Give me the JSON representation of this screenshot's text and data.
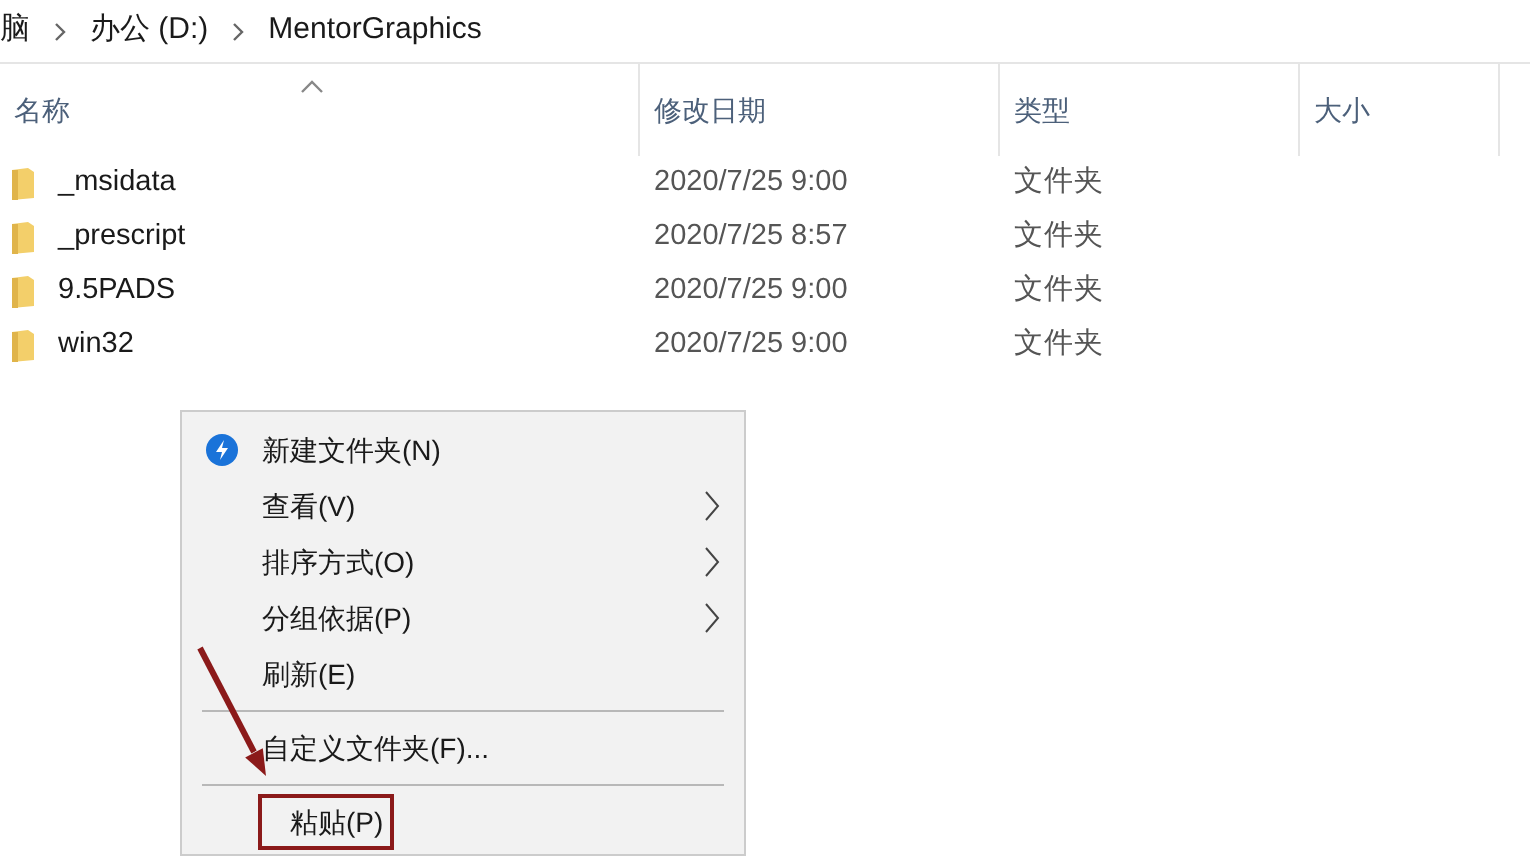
{
  "breadcrumb": [
    "脑",
    "办公 (D:)",
    "MentorGraphics"
  ],
  "table": {
    "columns": [
      {
        "label": "名称",
        "sorted": true
      },
      {
        "label": "修改日期",
        "sorted": false
      },
      {
        "label": "类型",
        "sorted": false
      },
      {
        "label": "大小",
        "sorted": false
      }
    ],
    "rows": [
      {
        "name": "_msidata",
        "date": "2020/7/25 9:00",
        "type": "文件夹"
      },
      {
        "name": "_prescript",
        "date": "2020/7/25 8:57",
        "type": "文件夹"
      },
      {
        "name": "9.5PADS",
        "date": "2020/7/25 9:00",
        "type": "文件夹"
      },
      {
        "name": "win32",
        "date": "2020/7/25 9:00",
        "type": "文件夹"
      }
    ]
  },
  "context_menu": {
    "items": [
      {
        "kind": "icon-item",
        "label": "新建文件夹(N)",
        "submenu": false,
        "highlighted": false
      },
      {
        "kind": "item",
        "label": "查看(V)",
        "submenu": true,
        "highlighted": false
      },
      {
        "kind": "item",
        "label": "排序方式(O)",
        "submenu": true,
        "highlighted": false
      },
      {
        "kind": "item",
        "label": "分组依据(P)",
        "submenu": true,
        "highlighted": false
      },
      {
        "kind": "item",
        "label": "刷新(E)",
        "submenu": false,
        "highlighted": false
      },
      {
        "kind": "separator"
      },
      {
        "kind": "item",
        "label": "自定义文件夹(F)...",
        "submenu": false,
        "highlighted": false
      },
      {
        "kind": "separator"
      },
      {
        "kind": "item",
        "label": "粘贴(P)",
        "submenu": false,
        "highlighted": true
      }
    ]
  }
}
